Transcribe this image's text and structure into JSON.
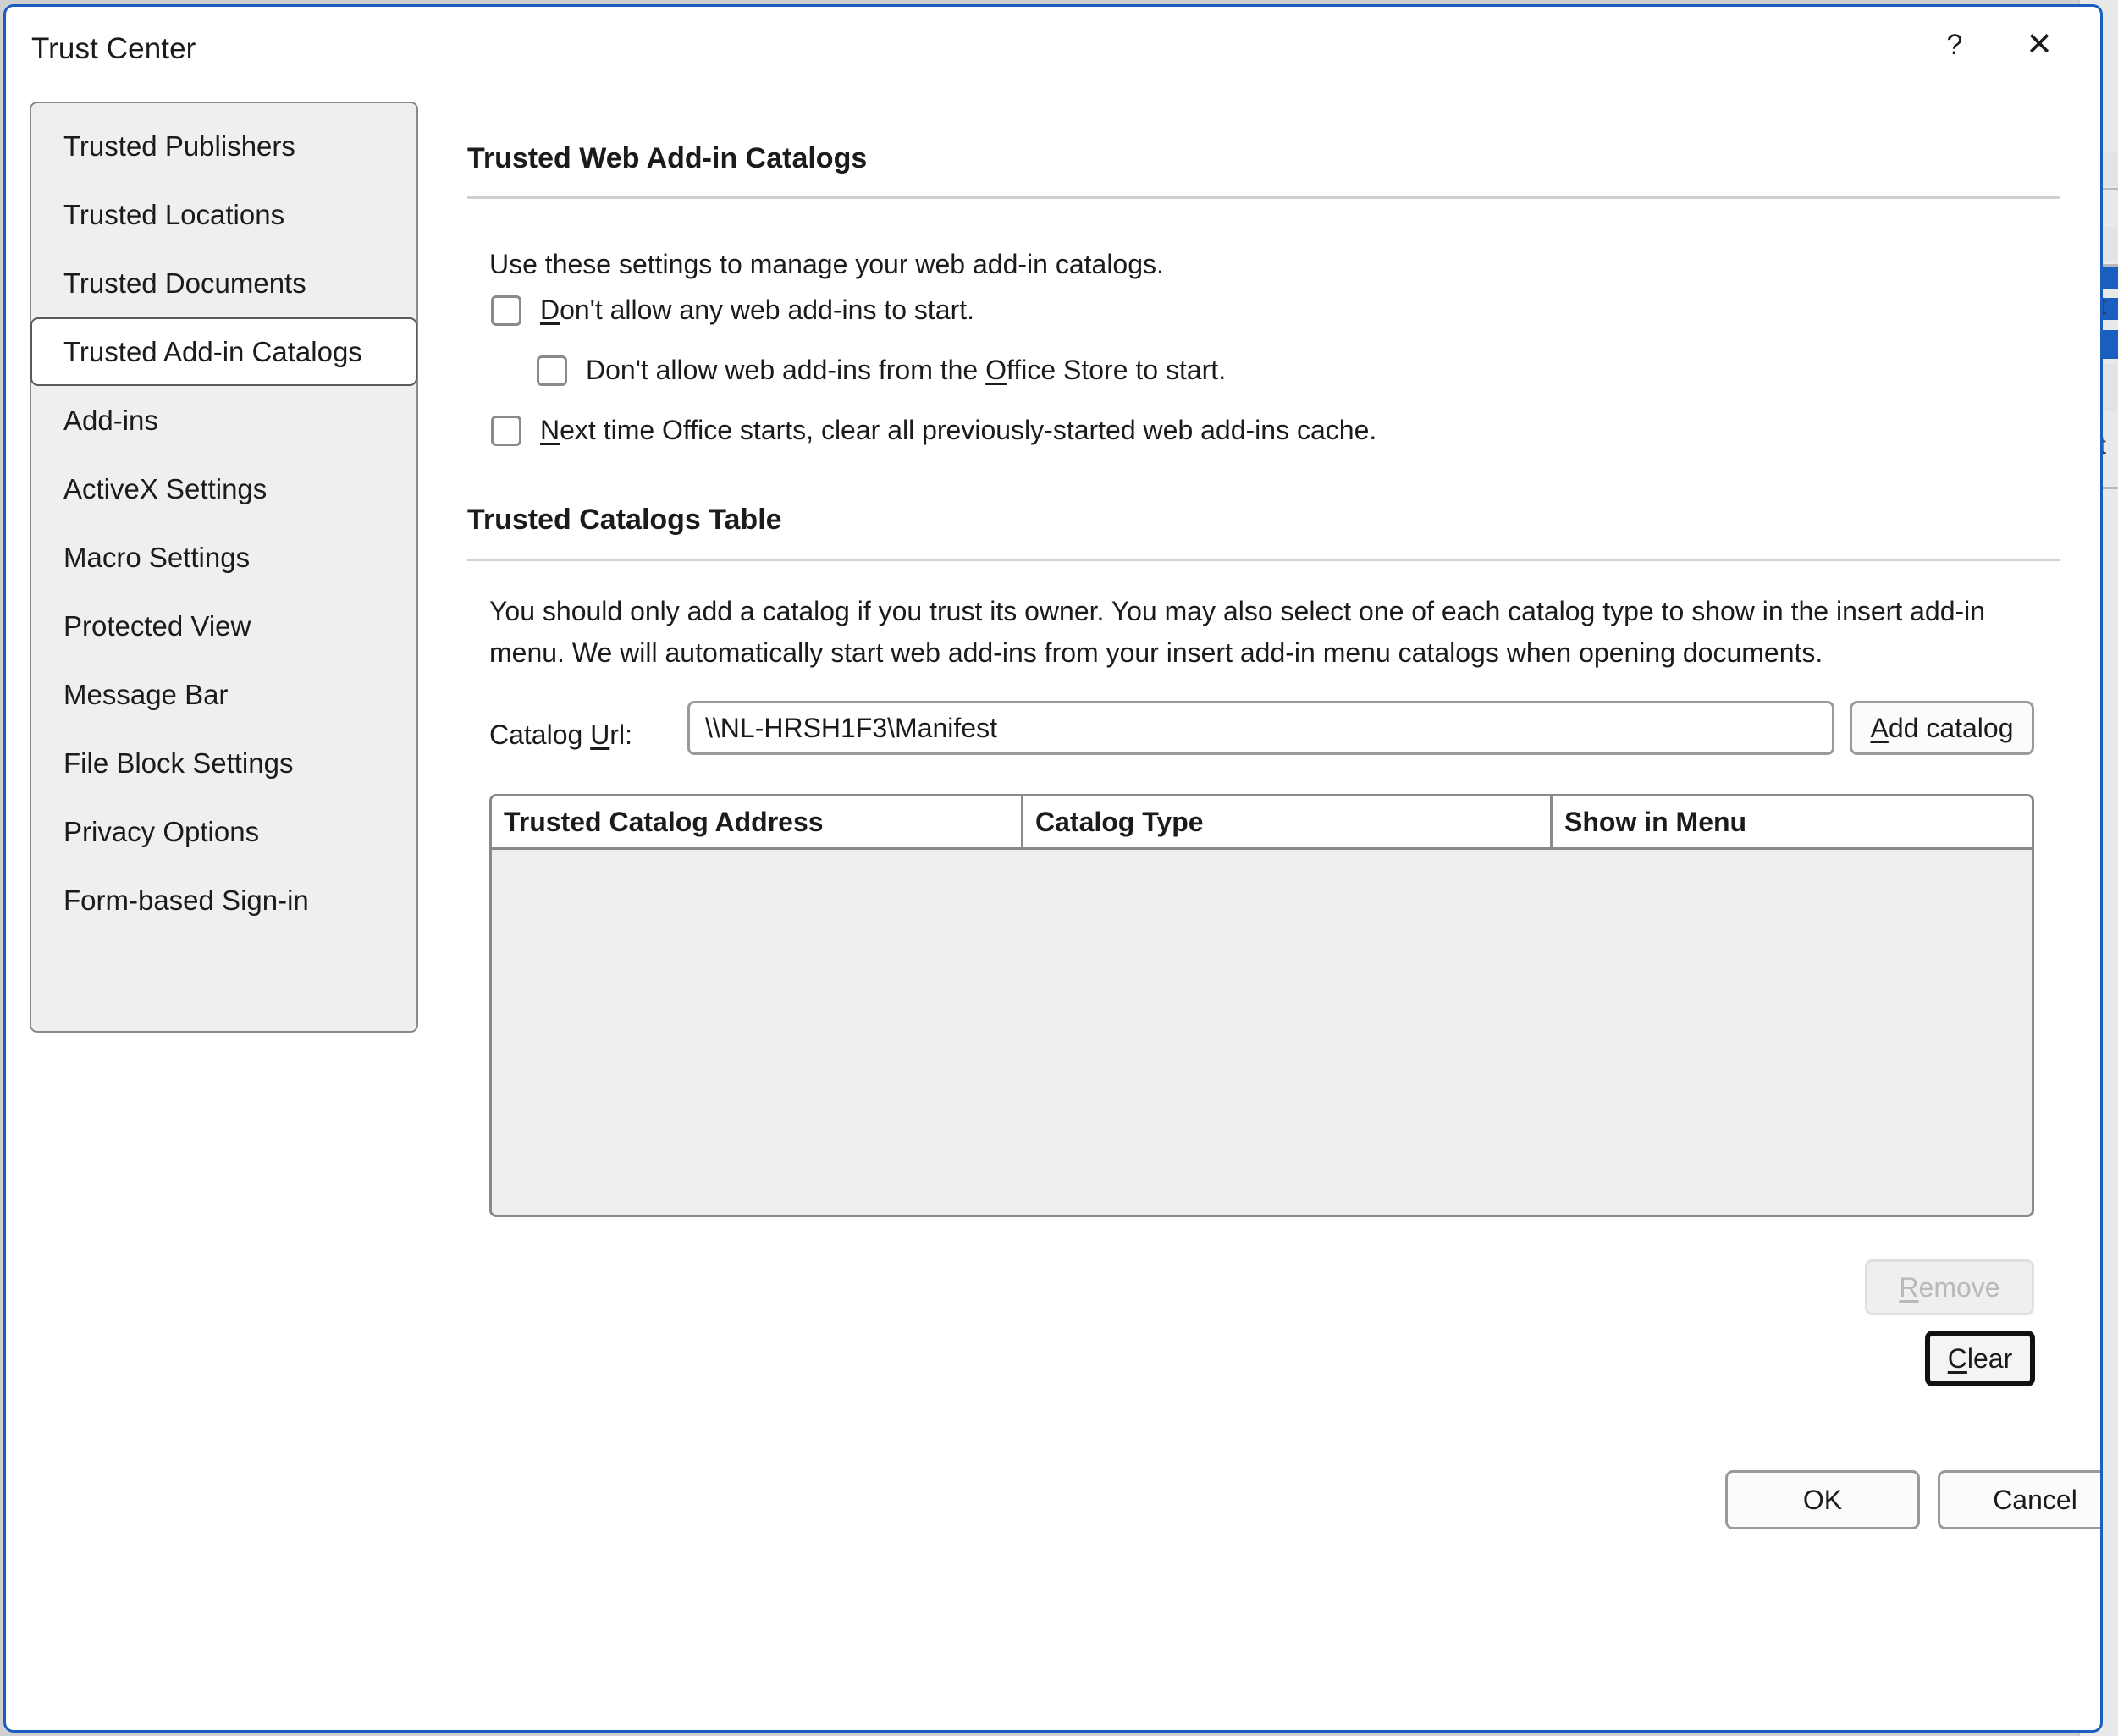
{
  "window": {
    "title": "Trust Center",
    "help_icon": "question-mark-icon",
    "close_icon": "close-x-icon",
    "help_glyph": "?",
    "close_glyph": "✕",
    "border_color": "#1a5fbf"
  },
  "sidebar": {
    "items": [
      {
        "label": "Trusted Publishers",
        "selected": false
      },
      {
        "label": "Trusted Locations",
        "selected": false
      },
      {
        "label": "Trusted Documents",
        "selected": false
      },
      {
        "label": "Trusted Add-in Catalogs",
        "selected": true
      },
      {
        "label": "Add-ins",
        "selected": false
      },
      {
        "label": "ActiveX Settings",
        "selected": false
      },
      {
        "label": "Macro Settings",
        "selected": false
      },
      {
        "label": "Protected View",
        "selected": false
      },
      {
        "label": "Message Bar",
        "selected": false
      },
      {
        "label": "File Block Settings",
        "selected": false
      },
      {
        "label": "Privacy Options",
        "selected": false
      },
      {
        "label": "Form-based Sign-in",
        "selected": false
      }
    ]
  },
  "web_catalogs": {
    "heading": "Trusted Web Add-in Catalogs",
    "intro": "Use these settings to manage your web add-in catalogs.",
    "checkbox_1": {
      "accel": "D",
      "rest": "on't allow any web add-ins to start.",
      "checked": false
    },
    "checkbox_2": {
      "pre": "Don't allow web add-ins from the ",
      "accel": "O",
      "rest": "ffice Store to start.",
      "checked": false
    },
    "checkbox_3": {
      "accel": "N",
      "rest": "ext time Office starts, clear all previously-started web add-ins cache.",
      "checked": false
    }
  },
  "catalogs_table": {
    "heading": "Trusted Catalogs Table",
    "description": "You should only add a catalog if you trust its owner. You may also select one of each catalog type to show in the insert add-in menu. We will automatically start web add-ins from your insert add-in menu catalogs when opening documents.",
    "url_label_pre": "Catalog ",
    "url_label_accel": "U",
    "url_label_rest": "rl:",
    "url_value": "\\\\NL-HRSH1F3\\Manifest",
    "url_placeholder": "",
    "add_button": {
      "accel": "A",
      "rest": "dd catalog"
    },
    "columns": [
      "Trusted Catalog Address",
      "Catalog Type",
      "Show in Menu"
    ],
    "rows": []
  },
  "actions": {
    "remove": {
      "accel": "R",
      "rest": "emove",
      "disabled": true
    },
    "clear": {
      "accel": "C",
      "rest": "lear",
      "focused": true
    },
    "ok": "OK",
    "cancel": "Cancel"
  }
}
